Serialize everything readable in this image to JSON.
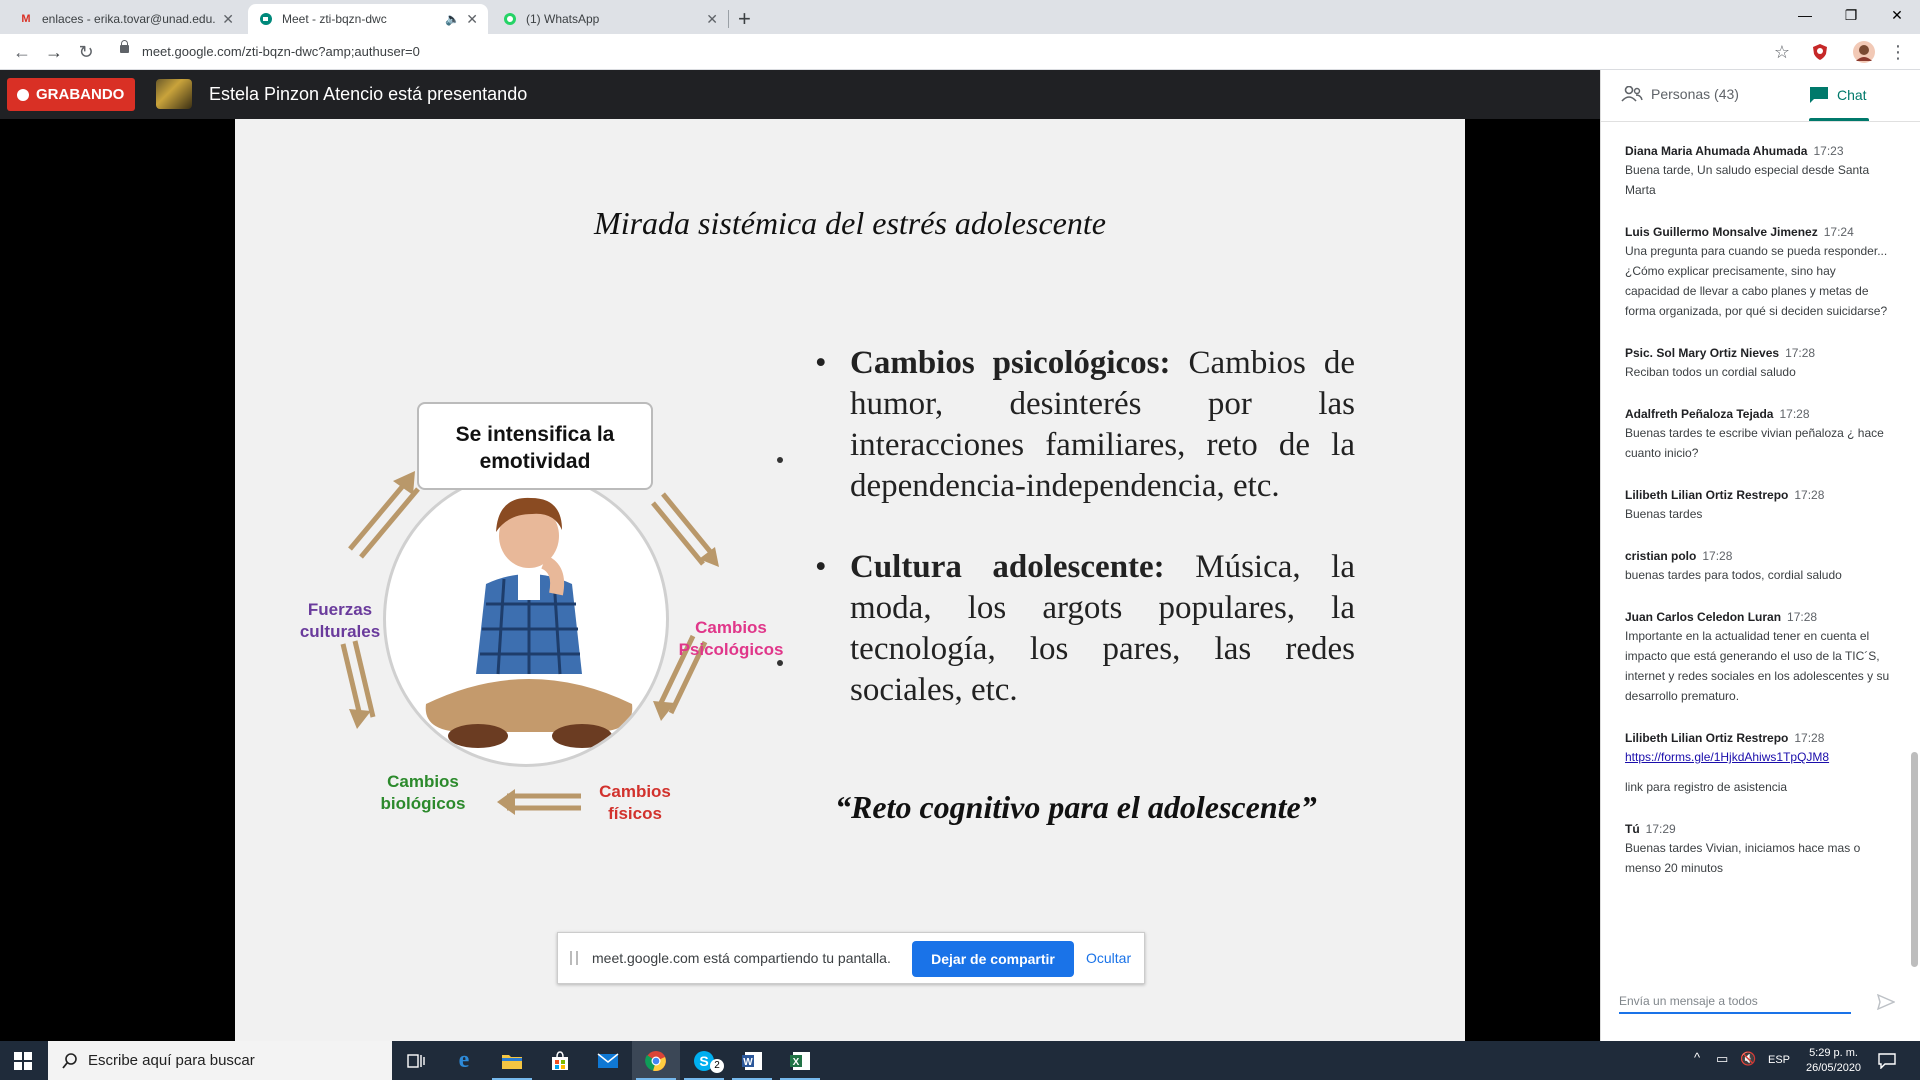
{
  "browser": {
    "tabs": [
      {
        "title": "enlaces - erika.tovar@unad.edu.c",
        "icon": "gmail-icon"
      },
      {
        "title": "Meet - zti-bqzn-dwc",
        "icon": "meet-icon",
        "active": true
      },
      {
        "title": "(1) WhatsApp",
        "icon": "whatsapp-icon"
      }
    ],
    "url": "meet.google.com/zti-bqzn-dwc?amp;authuser=0"
  },
  "meet": {
    "recording_label": "GRABANDO",
    "presenter_text": "Estela Pinzon Atencio está presentando",
    "share_notice": {
      "message": "meet.google.com está compartiendo tu pantalla.",
      "stop_label": "Dejar de compartir",
      "hide_label": "Ocultar"
    }
  },
  "slide": {
    "title": "Mirada sistémica del estrés adolescente",
    "bullets": [
      {
        "heading": "Cambios psicológicos:",
        "text": " Cambios de humor, desinterés por las interacciones familiares, reto de la dependencia-independencia, etc."
      },
      {
        "heading": "Cultura adolescente:",
        "text": " Música, la moda, los argots populares, la tecnología, los pares, las redes sociales, etc."
      }
    ],
    "quote": "“Reto cognitivo para el adolescente”",
    "diagram": {
      "bubble": "Se intensifica la emotividad",
      "labels": {
        "culturales": "Fuerzas culturales",
        "psicologicos": "Cambios Psicológicos",
        "biologicos": "Cambios biológicos",
        "fisicos": "Cambios físicos"
      }
    }
  },
  "sidebar": {
    "people_tab": "Personas (43)",
    "chat_tab": "Chat",
    "messages": [
      {
        "sender": "Diana Maria Ahumada Ahumada",
        "time": "17:23",
        "text": "Buena tarde, Un saludo especial desde Santa Marta"
      },
      {
        "sender": "Luis Guillermo Monsalve Jimenez",
        "time": "17:24",
        "text": "Una pregunta para cuando se pueda responder... ¿Cómo explicar precisamente, sino hay capacidad de llevar a cabo planes y metas de forma organizada, por qué si deciden suicidarse?"
      },
      {
        "sender": "Psic. Sol Mary Ortiz Nieves",
        "time": "17:28",
        "text": "Reciban todos un cordial saludo"
      },
      {
        "sender": "Adalfreth Peñaloza Tejada",
        "time": "17:28",
        "text": "Buenas tardes te escribe vivian peñaloza ¿ hace cuanto inicio?"
      },
      {
        "sender": "Lilibeth Lilian Ortiz Restrepo",
        "time": "17:28",
        "text": "Buenas tardes"
      },
      {
        "sender": "cristian polo",
        "time": "17:28",
        "text": "buenas tardes para todos, cordial saludo"
      },
      {
        "sender": "Juan Carlos Celedon Luran",
        "time": "17:28",
        "text": "Importante en la actualidad tener en cuenta el impacto que está generando el uso de la TIC´S, internet y redes sociales en los adolescentes y su desarrollo prematuro."
      },
      {
        "sender": "Lilibeth Lilian Ortiz Restrepo",
        "time": "17:28",
        "link": "https://forms.gle/1HjkdAhiws1TpQJM8",
        "text": "link para registro de asistencia"
      },
      {
        "sender": "Tú",
        "time": "17:29",
        "text": "Buenas tardes Vivian, iniciamos hace mas o menso 20 minutos"
      }
    ],
    "compose_placeholder": "Envía un mensaje a todos"
  },
  "taskbar": {
    "search_placeholder": "Escribe aquí para buscar",
    "language": "ESP",
    "time": "5:29 p. m.",
    "date": "26/05/2020",
    "skype_badge": "2"
  }
}
